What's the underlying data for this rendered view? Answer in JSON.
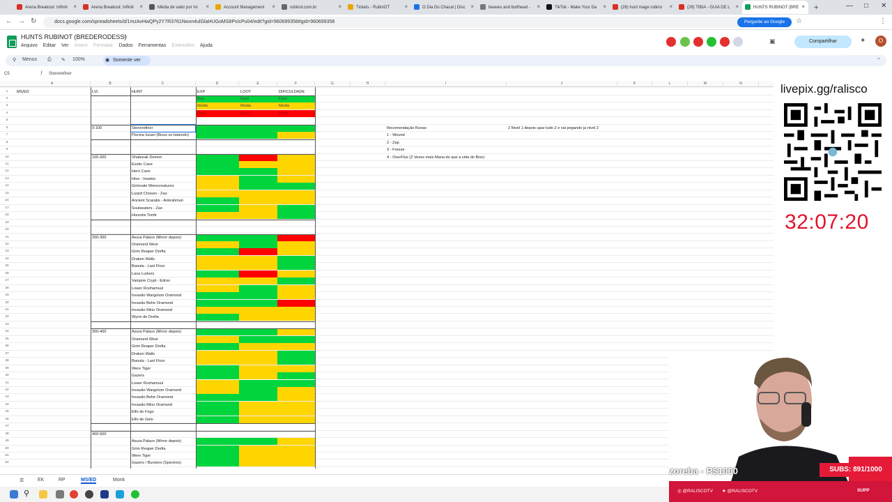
{
  "browser": {
    "tabs": [
      {
        "label": "Arena Breakout: Infiniti",
        "color": "#d93025"
      },
      {
        "label": "Arena Breakout: Infiniti",
        "color": "#d93025"
      },
      {
        "label": "Média de valor por mi",
        "color": "#555555"
      },
      {
        "label": "Account Management",
        "color": "#e8a600"
      },
      {
        "label": "rubinot.com.br",
        "color": "#666666"
      },
      {
        "label": "Tickets - RubinOT",
        "color": "#e8a600"
      },
      {
        "label": "O Dia Do Chacal | Disc",
        "color": "#1a73e8"
      },
      {
        "label": "beaves and butthead -",
        "color": "#777777"
      },
      {
        "label": "TikTok - Make Your Da",
        "color": "#111111"
      },
      {
        "label": "(28) hunt mage rubino",
        "color": "#d93025"
      },
      {
        "label": "(28) TIBIA - GUIA DE L",
        "color": "#d93025"
      },
      {
        "label": "HUNTS RUBINOT (BRE",
        "color": "#0f9d58",
        "active": true
      }
    ],
    "url": "docs.google.com/spreadsheets/d/1mzAvHwQPy2Y7R3761Nwxn4ulGlaHUGoMS8PsIcPu04/edit?gid=960699358#gid=960699358",
    "ask_google": "Pergunte ao Google"
  },
  "sheet": {
    "title": "HUNTS RUBINOT (BREDERODESS)",
    "menus": [
      {
        "label": "Arquivo"
      },
      {
        "label": "Editar"
      },
      {
        "label": "Ver"
      },
      {
        "label": "Inserir",
        "dim": true
      },
      {
        "label": "Formatar",
        "dim": true
      },
      {
        "label": "Dados"
      },
      {
        "label": "Ferramentas"
      },
      {
        "label": "Extensões",
        "dim": true
      },
      {
        "label": "Ajuda"
      }
    ],
    "share": "Compartilhar",
    "avatar": "O",
    "toolbar": {
      "menus": "Menus",
      "zoom": "100%",
      "view_only": "Somente ver"
    },
    "cell_ref": "C5",
    "formula_value": "Stonerefiner",
    "columns": [
      "A",
      "B",
      "C",
      "D",
      "E",
      "F",
      "G",
      "H",
      "I",
      "J",
      "K",
      "L",
      "M",
      "N"
    ],
    "header_row": {
      "a": "MS/ED",
      "lvl": "LVL",
      "hunt": "HUNT",
      "exp": "EXP",
      "loot": "LOOT",
      "dif": "DIFICULDADE"
    },
    "legend": [
      {
        "n": "2",
        "exp": "Boa",
        "loot": "Fácil",
        "dif": "Fácil",
        "c": "gr"
      },
      {
        "n": "3",
        "exp": "Media",
        "loot": "Media",
        "dif": "Media",
        "c": "ye"
      },
      {
        "n": "4",
        "exp": "Ruim",
        "loot": "Ruim",
        "dif": "Dificil",
        "c": "rd"
      }
    ],
    "runes": {
      "title": "Recomendação Runas",
      "items": [
        "1 - Wound",
        "2 - Zap",
        "3 - Freeze",
        "4 - OverFlux (2 Vezes mais Mana do que a vida do Bixo)"
      ],
      "note": "2 Nivel 1 depois upar tudo 2 e vai pegando ja nivel 2"
    },
    "rows": [
      {
        "n": "6",
        "lvl": "0-100",
        "hunt": "Stonerefiner",
        "e": "gr",
        "l": "gr",
        "d": "gr"
      },
      {
        "n": "7",
        "hunt": "Piscina Issavi (Bixos se batendo)",
        "e": "gr",
        "l": "gr",
        "d": "ye"
      },
      {
        "n": "8"
      },
      {
        "n": "9"
      },
      {
        "n": "10",
        "lvl": "100-200",
        "hunt": "Shaburak Demon",
        "e": "gr",
        "l": "rd",
        "d": "ye"
      },
      {
        "n": "11",
        "hunt": "Exotic Cave",
        "e": "gr",
        "l": "ye",
        "d": "ye"
      },
      {
        "n": "12",
        "hunt": "Hero Cave",
        "e": "gr",
        "l": "gr",
        "d": "ye"
      },
      {
        "n": "13",
        "hunt": "Hive - Insetos",
        "e": "ye",
        "l": "gr",
        "d": "ye"
      },
      {
        "n": "14",
        "hunt": "Grimvale Werecreatures",
        "e": "ye",
        "l": "gr",
        "d": "gr"
      },
      {
        "n": "15",
        "hunt": "Lizard Chosen - Zao",
        "e": "ye",
        "l": "ye",
        "d": "ye"
      },
      {
        "n": "16",
        "hunt": "Ancient Scarabs - Ankrahmun",
        "e": "gr",
        "l": "ye",
        "d": "ye"
      },
      {
        "n": "17",
        "hunt": "Soulseaters - Zao",
        "e": "gr",
        "l": "ye",
        "d": "gr"
      },
      {
        "n": "18",
        "hunt": "Horestis Tomb",
        "e": "ye",
        "l": "ye",
        "d": "gr"
      },
      {
        "n": "19"
      },
      {
        "n": "20"
      },
      {
        "n": "21",
        "lvl": "200-300",
        "hunt": "Asura Palace (Mirror depois)",
        "e": "gr",
        "l": "gr",
        "d": "rd"
      },
      {
        "n": "22",
        "hunt": "Oramond West",
        "e": "ye",
        "l": "gr",
        "d": "ye"
      },
      {
        "n": "23",
        "hunt": "Grim Reaper Drefia",
        "e": "gr",
        "l": "rd",
        "d": "ye"
      },
      {
        "n": "24",
        "hunt": "Draken Walls",
        "e": "ye",
        "l": "ye",
        "d": "gr"
      },
      {
        "n": "25",
        "hunt": "Banuta - Last Floor",
        "e": "ye",
        "l": "ye",
        "d": "gr"
      },
      {
        "n": "26",
        "hunt": "Lava Lurkers",
        "e": "gr",
        "l": "rd",
        "d": "ye"
      },
      {
        "n": "27",
        "hunt": "Vampire Crypt - Edron",
        "e": "ye",
        "l": "ye",
        "d": "gr"
      },
      {
        "n": "28",
        "hunt": "Lower Roshamuul",
        "e": "ye",
        "l": "gr",
        "d": "ye"
      },
      {
        "n": "29",
        "hunt": "Invasão Wargolum Oramond",
        "e": "gr",
        "l": "gr",
        "d": "ye"
      },
      {
        "n": "30",
        "hunt": "Invasão Behe Oramond",
        "e": "gr",
        "l": "gr",
        "d": "rd"
      },
      {
        "n": "31",
        "hunt": "Invasão Mino Oramond",
        "e": "ye",
        "l": "ye",
        "d": "ye"
      },
      {
        "n": "32",
        "hunt": "Wyrm de Drefia",
        "e": "gr",
        "l": "ye",
        "d": "ye"
      },
      {
        "n": "33"
      },
      {
        "n": "34",
        "lvl": "300-400",
        "hunt": "Asura Palace (Mirror depois)",
        "e": "gr",
        "l": "gr",
        "d": "ye"
      },
      {
        "n": "35",
        "hunt": "Oramond West",
        "e": "ye",
        "l": "gr",
        "d": "gr"
      },
      {
        "n": "36",
        "hunt": "Grim Reaper Drefia",
        "e": "gr",
        "l": "ye",
        "d": "ye"
      },
      {
        "n": "37",
        "hunt": "Draken Walls",
        "e": "ye",
        "l": "ye",
        "d": "gr"
      },
      {
        "n": "38",
        "hunt": "Banuta - Last Floor",
        "e": "ye",
        "l": "ye",
        "d": "gr"
      },
      {
        "n": "39",
        "hunt": "Were Tiger",
        "e": "gr",
        "l": "ye",
        "d": "ye"
      },
      {
        "n": "40",
        "hunt": "Gazers",
        "e": "gr",
        "l": "ye",
        "d": "gr"
      },
      {
        "n": "41",
        "hunt": "Lower Roshamuul",
        "e": "ye",
        "l": "gr",
        "d": "gr"
      },
      {
        "n": "42",
        "hunt": "Invasão Wargolum Oramond",
        "e": "ye",
        "l": "gr",
        "d": "ye"
      },
      {
        "n": "43",
        "hunt": "Invasão Behe Oramond",
        "e": "gr",
        "l": "gr",
        "d": "ye"
      },
      {
        "n": "44",
        "hunt": "Invasão Mino Oramond",
        "e": "gr",
        "l": "ye",
        "d": "ye"
      },
      {
        "n": "45",
        "hunt": "Elfo de Fogo",
        "e": "gr",
        "l": "ye",
        "d": "ye"
      },
      {
        "n": "46",
        "hunt": "Elfo de Gelo",
        "e": "gr",
        "l": "ye",
        "d": "ye"
      },
      {
        "n": "47"
      },
      {
        "n": "48",
        "lvl": "400-500"
      },
      {
        "n": "49",
        "hunt": "Asura Palace (Mirror depois)",
        "e": "gr",
        "l": "gr",
        "d": "ye"
      },
      {
        "n": "50",
        "hunt": "Grim Reaper Drefia",
        "e": "gr",
        "l": "ye",
        "d": "ye"
      },
      {
        "n": "51",
        "hunt": "Were Tiger",
        "e": "gr",
        "l": "ye",
        "d": "ye"
      },
      {
        "n": "52",
        "hunt": "Gazers / Bursters (Spectres)",
        "e": "gr",
        "l": "ye",
        "d": "ye"
      }
    ],
    "sheet_tabs": [
      {
        "label": "EK"
      },
      {
        "label": "RP"
      },
      {
        "label": "MS/ED",
        "active": true
      },
      {
        "label": "Monk"
      }
    ]
  },
  "overlay": {
    "livepix": "livepix.gg/ralisco",
    "timer": "32:07:20",
    "goal": "zoreba - R$1000",
    "subs": "SUBS: 891/1000",
    "social_1": "@RALISCOTV",
    "social_2": "@RALISCOTV",
    "supp": "SUPP"
  }
}
